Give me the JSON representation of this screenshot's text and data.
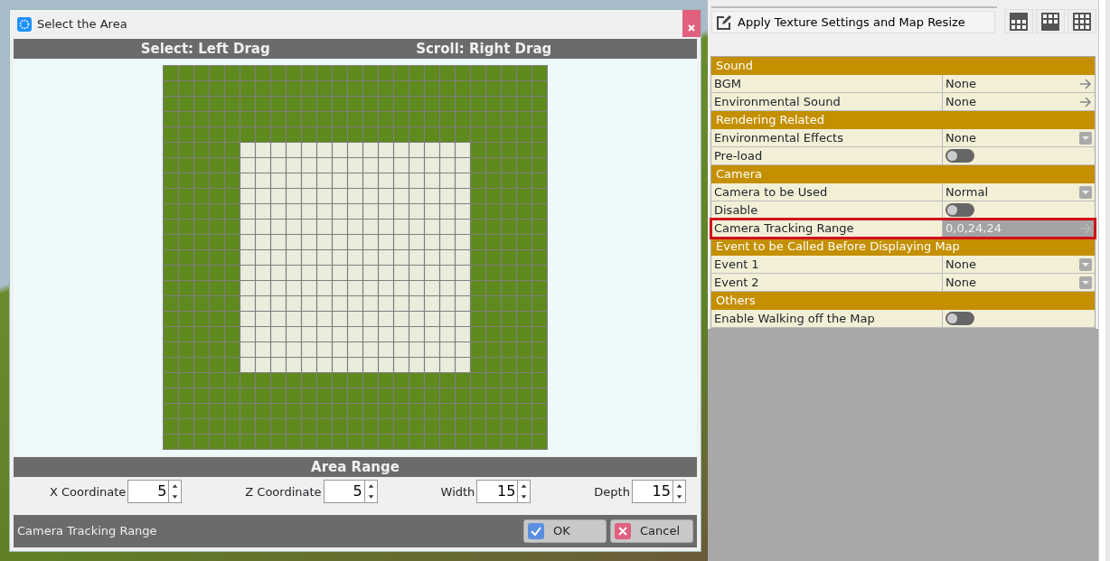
{
  "dialog": {
    "title": "Select the Area",
    "hints": [
      "Select: Left Drag",
      "Scroll: Right Drag"
    ],
    "area_range": {
      "title": "Area Range",
      "fields": [
        {
          "label": "X Coordinate",
          "value": "5"
        },
        {
          "label": "Z Coordinate",
          "value": "5"
        },
        {
          "label": "Width",
          "value": "15"
        },
        {
          "label": "Depth",
          "value": "15"
        }
      ]
    },
    "status": "Camera Tracking Range",
    "buttons": [
      {
        "label": "OK",
        "kind": "ok"
      },
      {
        "label": "Cancel",
        "kind": "cancel"
      }
    ]
  },
  "panel": {
    "apply_button": "Apply Texture Settings and Map Resize",
    "properties": [
      {
        "kind": "section",
        "label": "Sound"
      },
      {
        "kind": "link",
        "label": "BGM",
        "value": "None",
        "highlighted": false
      },
      {
        "kind": "link",
        "label": "Environmental Sound",
        "value": "None",
        "highlighted": false
      },
      {
        "kind": "section",
        "label": "Rendering Related"
      },
      {
        "kind": "dropdown",
        "label": "Environmental Effects",
        "value": "None",
        "highlighted": false
      },
      {
        "kind": "toggle",
        "label": "Pre-load",
        "on": false,
        "highlighted": false
      },
      {
        "kind": "section",
        "label": "Camera"
      },
      {
        "kind": "dropdown",
        "label": "Camera to be Used",
        "value": "Normal",
        "highlighted": false
      },
      {
        "kind": "toggle",
        "label": "Disable",
        "on": false,
        "highlighted": false
      },
      {
        "kind": "link",
        "label": "Camera Tracking Range",
        "value": "0,0,24,24",
        "highlighted": true
      },
      {
        "kind": "section",
        "label": "Event to be Called Before Displaying Map"
      },
      {
        "kind": "dropdown",
        "label": "Event 1",
        "value": "None",
        "highlighted": false
      },
      {
        "kind": "dropdown",
        "label": "Event 2",
        "value": "None",
        "highlighted": false
      },
      {
        "kind": "section",
        "label": "Others"
      },
      {
        "kind": "toggle",
        "label": "Enable Walking off the Map",
        "on": false,
        "highlighted": false
      }
    ]
  }
}
